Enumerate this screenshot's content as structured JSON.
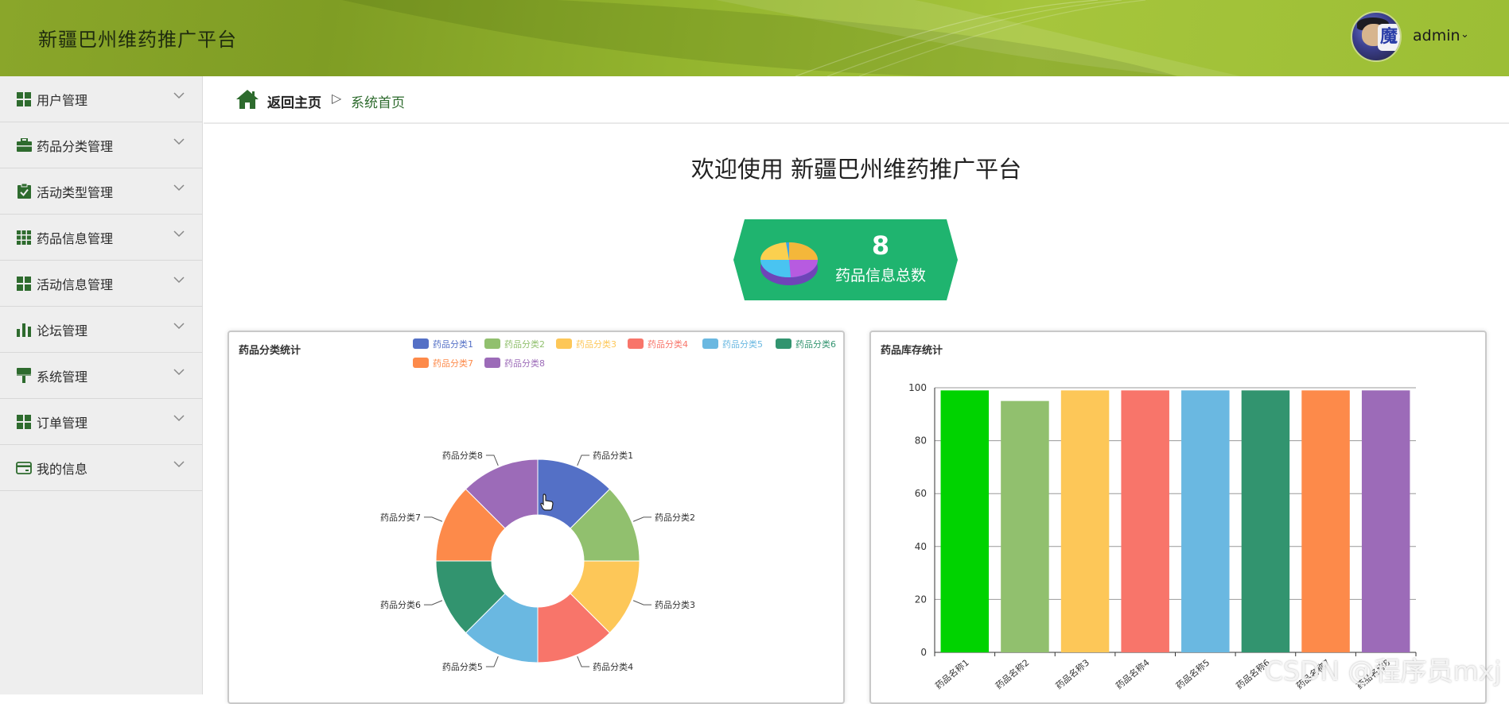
{
  "header": {
    "app_title": "新疆巴州维药推广平台",
    "avatar_badge": "魔",
    "user_name": "admin",
    "user_caret": "⌄"
  },
  "sidebar": {
    "items": [
      {
        "label": "用户管理",
        "icon": "grid-icon"
      },
      {
        "label": "药品分类管理",
        "icon": "briefcase-icon"
      },
      {
        "label": "活动类型管理",
        "icon": "clipboard-check-icon"
      },
      {
        "label": "药品信息管理",
        "icon": "apps-grid-icon"
      },
      {
        "label": "活动信息管理",
        "icon": "grid-icon"
      },
      {
        "label": "论坛管理",
        "icon": "bar-chart-icon"
      },
      {
        "label": "系统管理",
        "icon": "brush-icon"
      },
      {
        "label": "订单管理",
        "icon": "grid-icon"
      },
      {
        "label": "我的信息",
        "icon": "card-icon"
      }
    ]
  },
  "breadcrumb": {
    "back_label": "返回主页",
    "separator": "▷",
    "current": "系统首页"
  },
  "main": {
    "welcome": "欢迎使用 新疆巴州维药推广平台",
    "stat": {
      "value": "8",
      "label": "药品信息总数"
    }
  },
  "colors": {
    "accent": "#1fb46f",
    "breadcrumb_icon": "#2e6b2e",
    "sidebar_icon": "#2e6b2e"
  },
  "chart_data": [
    {
      "type": "pie",
      "title": "药品分类统计",
      "donut": true,
      "legend_position": "top-right",
      "slices": [
        {
          "label": "药品分类1",
          "value": 1,
          "color": "#5470c6"
        },
        {
          "label": "药品分类2",
          "value": 1,
          "color": "#91c06e"
        },
        {
          "label": "药品分类3",
          "value": 1,
          "color": "#fdc758"
        },
        {
          "label": "药品分类4",
          "value": 1,
          "color": "#f8756a"
        },
        {
          "label": "药品分类5",
          "value": 1,
          "color": "#6ab8e1"
        },
        {
          "label": "药品分类6",
          "value": 1,
          "color": "#32946f"
        },
        {
          "label": "药品分类7",
          "value": 1,
          "color": "#fd8a4a"
        },
        {
          "label": "药品分类8",
          "value": 1,
          "color": "#9c6bb8"
        }
      ]
    },
    {
      "type": "bar",
      "title": "药品库存统计",
      "categories": [
        "药品名称1",
        "药品名称2",
        "药品名称3",
        "药品名称4",
        "药品名称5",
        "药品名称6",
        "药品名称7",
        "药品名称8"
      ],
      "values": [
        99,
        95,
        99,
        99,
        99,
        99,
        99,
        99
      ],
      "colors": [
        "#00d300",
        "#91c06e",
        "#fdc758",
        "#f8756a",
        "#6ab8e1",
        "#32946f",
        "#fd8a4a",
        "#9c6bb8"
      ],
      "ylim": [
        0,
        100
      ],
      "yticks": [
        0,
        20,
        40,
        60,
        80,
        100
      ],
      "grid": true
    }
  ],
  "watermark": "CSDN @程序员mxj"
}
